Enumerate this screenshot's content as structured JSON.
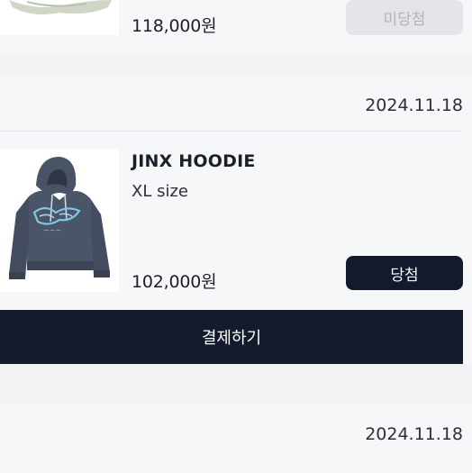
{
  "orders": [
    {
      "price": "118,000원",
      "status_label": "미당첨"
    },
    {
      "date": "2024.11.18",
      "product_name": "JINX HOODIE",
      "option": "XL size",
      "price": "102,000원",
      "status_label": "당첨",
      "pay_label": "결제하기"
    },
    {
      "date": "2024.11.18"
    }
  ],
  "colors": {
    "page_bg": "#f2f3f5",
    "card_bg": "#f6f7f9",
    "accent_dark": "#121a2c",
    "disabled_bg": "#e4e5e8",
    "disabled_text": "#b2b5bb",
    "hoodie": "#4a5568",
    "print": "#7ec8e3"
  }
}
